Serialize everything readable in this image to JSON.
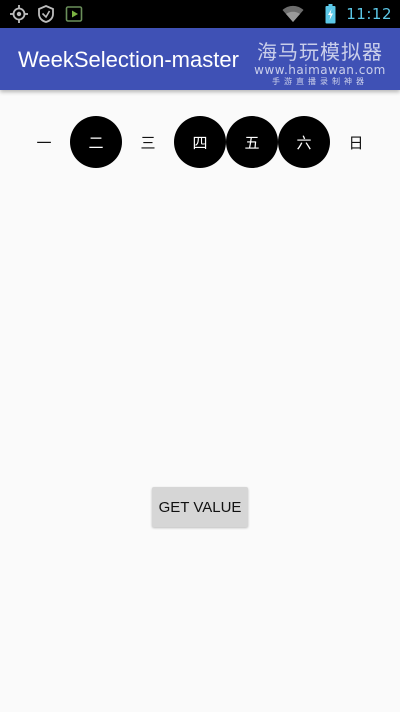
{
  "status_bar": {
    "time": "11:12",
    "icons": [
      "gps-icon",
      "shield-icon",
      "play-store-icon",
      "wifi-icon",
      "battery-icon"
    ],
    "time_color": "#5cc8e8"
  },
  "app_bar": {
    "title": "WeekSelection-master",
    "color": "#3f51b5"
  },
  "watermark": {
    "main": "海马玩模拟器",
    "url": "www.haimawan.com",
    "sub": "手游直播录制神器"
  },
  "week": {
    "days": [
      {
        "label": "一",
        "selected": false
      },
      {
        "label": "二",
        "selected": true
      },
      {
        "label": "三",
        "selected": false
      },
      {
        "label": "四",
        "selected": true
      },
      {
        "label": "五",
        "selected": true
      },
      {
        "label": "六",
        "selected": true
      },
      {
        "label": "日",
        "selected": false
      }
    ],
    "selected_color": "#000000"
  },
  "button": {
    "label": "GET VALUE"
  }
}
